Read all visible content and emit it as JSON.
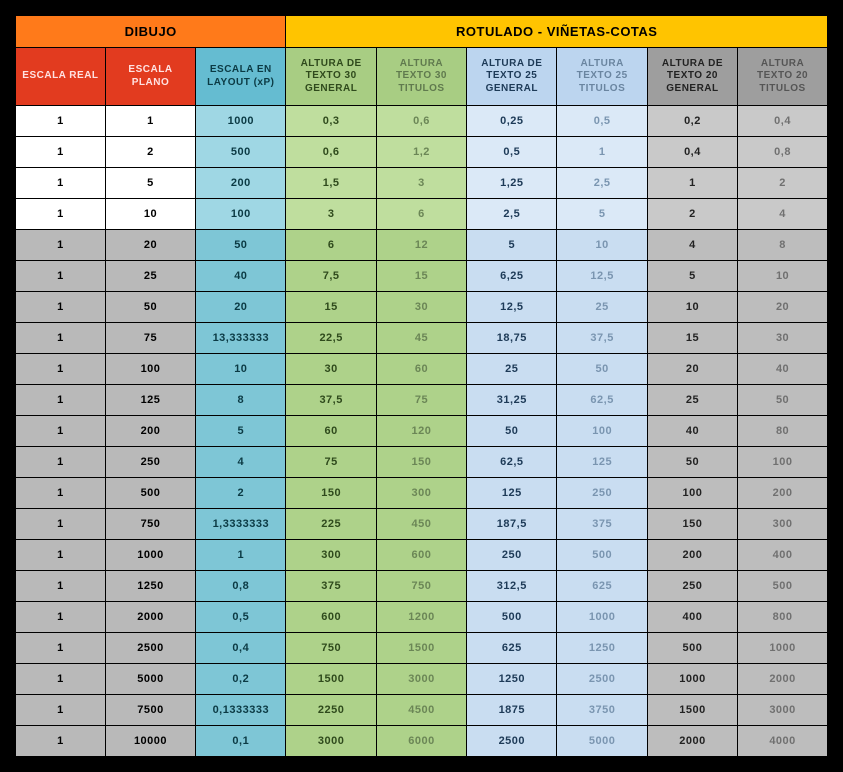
{
  "superheaders": {
    "dibujo": "DIBUJO",
    "rotulado": "ROTULADO - VIÑETAS-COTAS"
  },
  "colheaders": {
    "escala_real": "ESCALA REAL",
    "escala_plano": "ESCALA PLANO",
    "escala_layout": "ESCALA EN LAYOUT (xP)",
    "t30_general": "ALTURA DE TEXTO 30 GENERAL",
    "t30_titulos": "ALTURA TEXTO 30 TITULOS",
    "t25_general": "ALTURA DE TEXTO 25 GENERAL",
    "t25_titulos": "ALTURA TEXTO 25 TITULOS",
    "t20_general": "ALTURA DE TEXTO 20 GENERAL",
    "t20_titulos": "ALTURA TEXTO 20 TITULOS"
  },
  "columns": [
    "escala_real",
    "escala_plano",
    "escala_layout",
    "t30_general",
    "t30_titulos",
    "t25_general",
    "t25_titulos",
    "t20_general",
    "t20_titulos"
  ],
  "alt_rows": [
    4,
    5,
    6,
    7,
    8,
    9,
    10,
    11,
    12,
    13,
    14,
    15,
    16,
    17,
    18,
    19,
    20
  ],
  "rows": [
    [
      "1",
      "1",
      "1000",
      "0,3",
      "0,6",
      "0,25",
      "0,5",
      "0,2",
      "0,4"
    ],
    [
      "1",
      "2",
      "500",
      "0,6",
      "1,2",
      "0,5",
      "1",
      "0,4",
      "0,8"
    ],
    [
      "1",
      "5",
      "200",
      "1,5",
      "3",
      "1,25",
      "2,5",
      "1",
      "2"
    ],
    [
      "1",
      "10",
      "100",
      "3",
      "6",
      "2,5",
      "5",
      "2",
      "4"
    ],
    [
      "1",
      "20",
      "50",
      "6",
      "12",
      "5",
      "10",
      "4",
      "8"
    ],
    [
      "1",
      "25",
      "40",
      "7,5",
      "15",
      "6,25",
      "12,5",
      "5",
      "10"
    ],
    [
      "1",
      "50",
      "20",
      "15",
      "30",
      "12,5",
      "25",
      "10",
      "20"
    ],
    [
      "1",
      "75",
      "13,333333",
      "22,5",
      "45",
      "18,75",
      "37,5",
      "15",
      "30"
    ],
    [
      "1",
      "100",
      "10",
      "30",
      "60",
      "25",
      "50",
      "20",
      "40"
    ],
    [
      "1",
      "125",
      "8",
      "37,5",
      "75",
      "31,25",
      "62,5",
      "25",
      "50"
    ],
    [
      "1",
      "200",
      "5",
      "60",
      "120",
      "50",
      "100",
      "40",
      "80"
    ],
    [
      "1",
      "250",
      "4",
      "75",
      "150",
      "62,5",
      "125",
      "50",
      "100"
    ],
    [
      "1",
      "500",
      "2",
      "150",
      "300",
      "125",
      "250",
      "100",
      "200"
    ],
    [
      "1",
      "750",
      "1,3333333",
      "225",
      "450",
      "187,5",
      "375",
      "150",
      "300"
    ],
    [
      "1",
      "1000",
      "1",
      "300",
      "600",
      "250",
      "500",
      "200",
      "400"
    ],
    [
      "1",
      "1250",
      "0,8",
      "375",
      "750",
      "312,5",
      "625",
      "250",
      "500"
    ],
    [
      "1",
      "2000",
      "0,5",
      "600",
      "1200",
      "500",
      "1000",
      "400",
      "800"
    ],
    [
      "1",
      "2500",
      "0,4",
      "750",
      "1500",
      "625",
      "1250",
      "500",
      "1000"
    ],
    [
      "1",
      "5000",
      "0,2",
      "1500",
      "3000",
      "1250",
      "2500",
      "1000",
      "2000"
    ],
    [
      "1",
      "7500",
      "0,1333333",
      "2250",
      "4500",
      "1875",
      "3750",
      "1500",
      "3000"
    ],
    [
      "1",
      "10000",
      "0,1",
      "3000",
      "6000",
      "2500",
      "5000",
      "2000",
      "4000"
    ]
  ],
  "chart_data": {
    "type": "table",
    "title": "Escalas de dibujo y alturas de texto",
    "columns": [
      "ESCALA REAL",
      "ESCALA PLANO",
      "ESCALA EN LAYOUT (xP)",
      "ALTURA DE TEXTO 30 GENERAL",
      "ALTURA TEXTO 30 TITULOS",
      "ALTURA DE TEXTO 25 GENERAL",
      "ALTURA TEXTO 25 TITULOS",
      "ALTURA DE TEXTO 20 GENERAL",
      "ALTURA TEXTO 20 TITULOS"
    ],
    "rows_ref": "rows"
  }
}
